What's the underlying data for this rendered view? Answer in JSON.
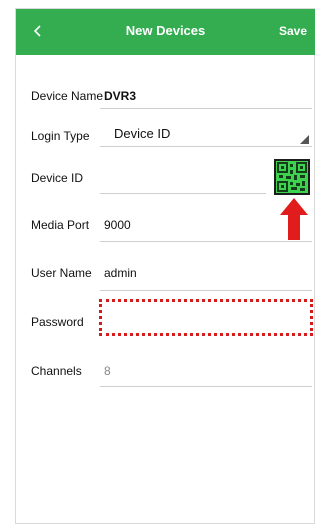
{
  "header": {
    "back_icon": "chevron-left-icon",
    "title": "New Devices",
    "save_label": "Save",
    "color": "#33ad50"
  },
  "form": {
    "device_name": {
      "label": "Device Name",
      "value": "DVR3"
    },
    "login_type": {
      "label": "Login Type",
      "value": "Device ID",
      "icon": "dropdown-triangle-icon"
    },
    "device_id": {
      "label": "Device ID",
      "value": "",
      "scan_icon": "qr-code-icon"
    },
    "media_port": {
      "label": "Media Port",
      "value": "9000"
    },
    "user_name": {
      "label": "User Name",
      "value": "admin"
    },
    "password": {
      "label": "Password",
      "value": ""
    },
    "channels": {
      "label": "Channels",
      "value": "8"
    }
  },
  "annotations": {
    "arrow_icon": "red-up-arrow-icon",
    "highlight_color": "#d51b1b"
  }
}
